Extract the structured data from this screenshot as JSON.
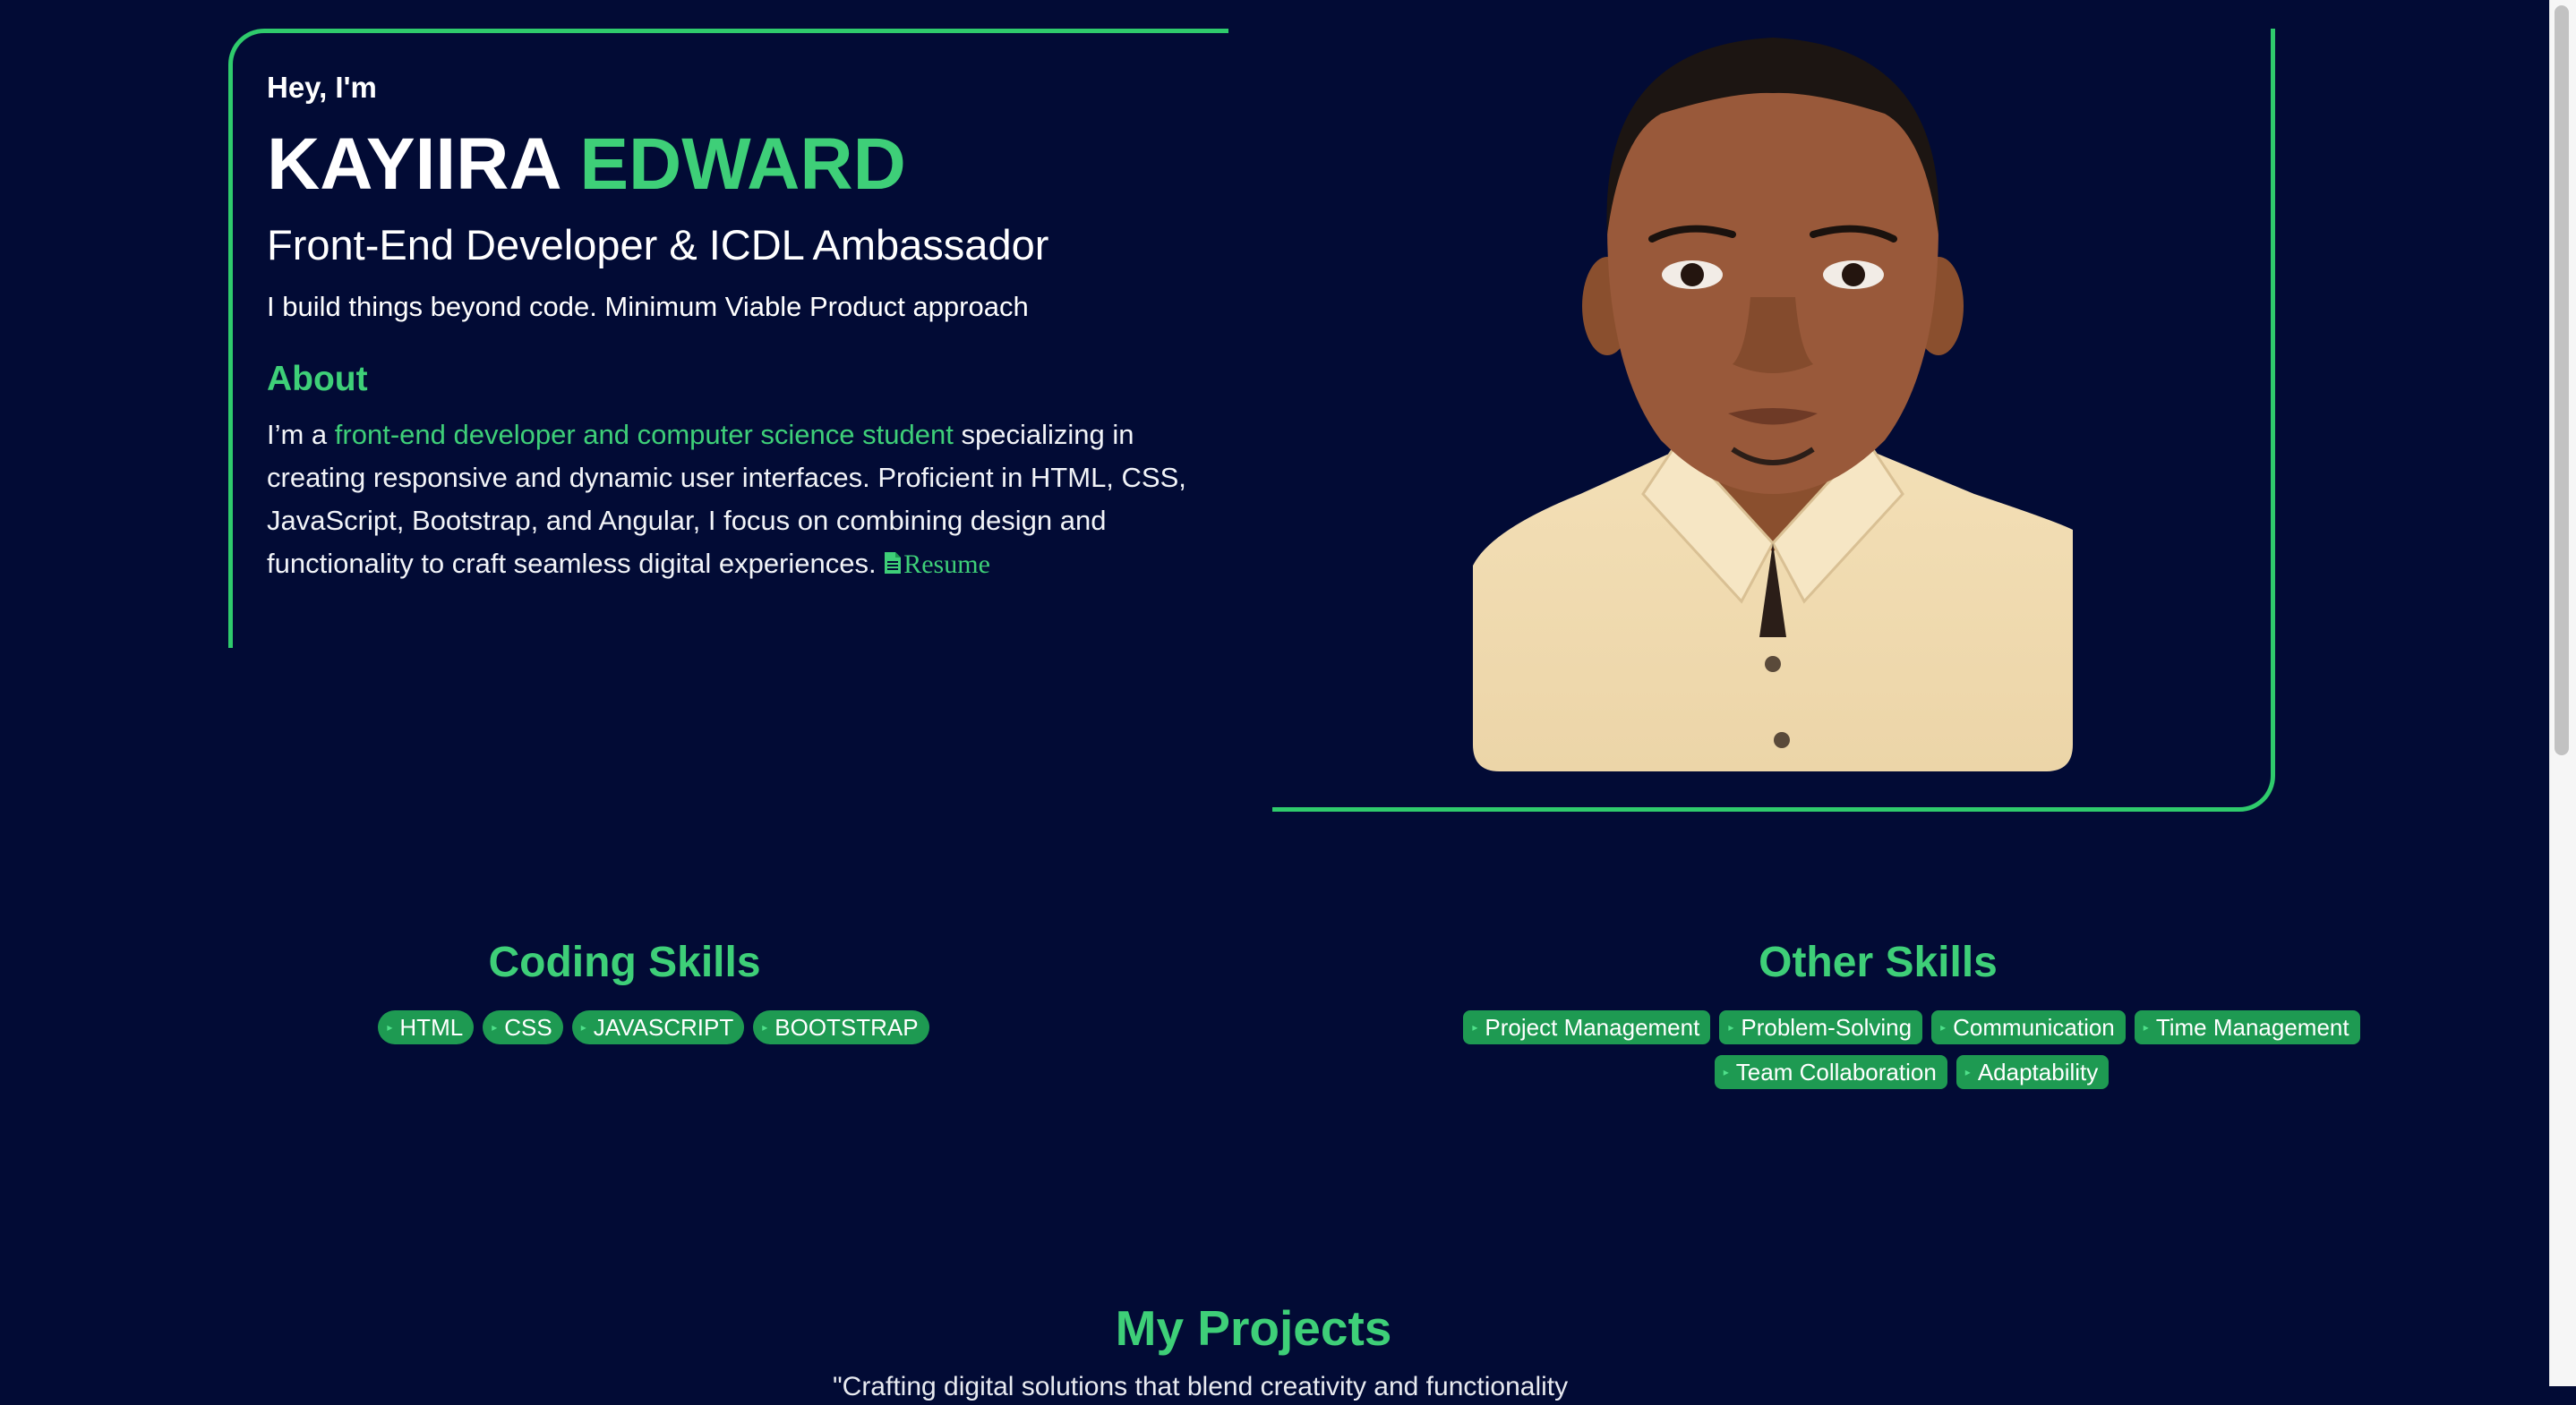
{
  "hero": {
    "greeting": "Hey, I'm",
    "first_name": "KAYIIRA",
    "last_name": "EDWARD",
    "role": "Front-End Developer & ICDL Ambassador",
    "tagline": "I build things beyond code. Minimum Viable Product approach"
  },
  "about": {
    "heading": "About",
    "prefix": "I’m a ",
    "highlight": "front-end developer and computer science student",
    "body": " specializing in creating responsive and dynamic user interfaces. Proficient in HTML, CSS, JavaScript, Bootstrap, and Angular, I focus on combining design and functionality to craft seamless digital experiences. ",
    "resume_label": "Resume",
    "resume_icon": "document-icon"
  },
  "coding_skills": {
    "heading": "Coding Skills",
    "items": [
      "HTML",
      "CSS",
      "JAVASCRIPT",
      "BOOTSTRAP"
    ]
  },
  "other_skills": {
    "heading": "Other Skills",
    "items": [
      "Project Management",
      "Problem-Solving",
      "Communication",
      "Time Management",
      "Team Collaboration",
      "Adaptability"
    ]
  },
  "projects": {
    "heading": "My Projects",
    "subtitle": "\"Crafting digital solutions that blend creativity and functionality"
  },
  "colors": {
    "background": "#020b35",
    "accent": "#3ecf78",
    "chip": "#1e9a52"
  }
}
